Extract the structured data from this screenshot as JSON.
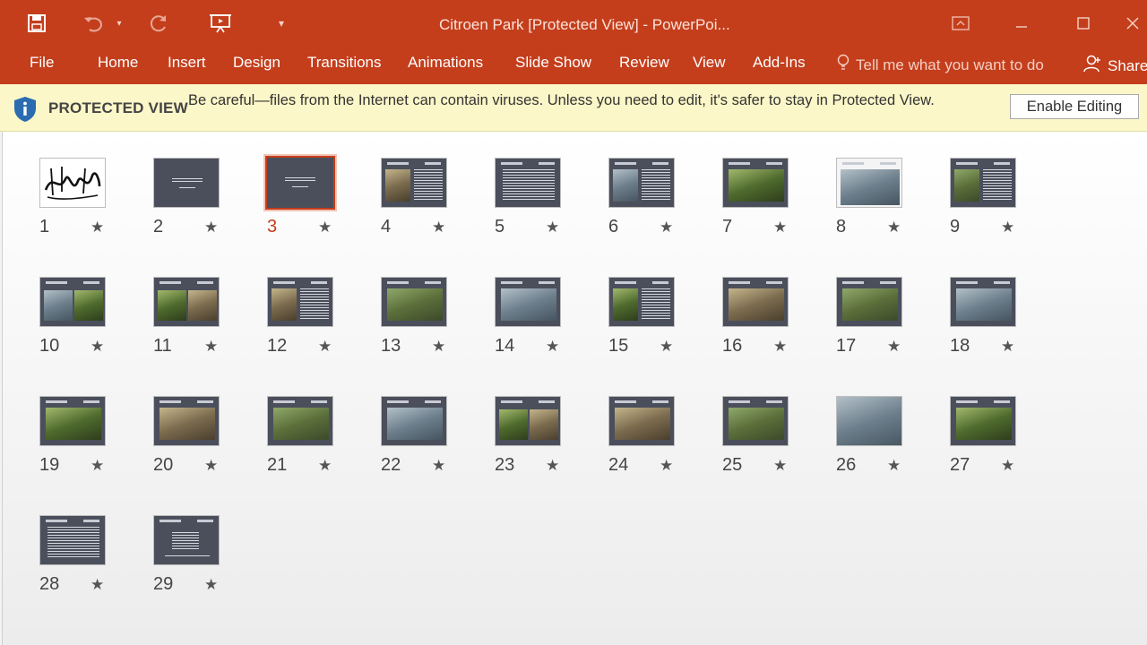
{
  "window": {
    "title": "Citroen Park [Protected View] - PowerPoi...",
    "icons": [
      "save-icon",
      "undo-icon",
      "redo-icon",
      "slideshow-from-start-icon",
      "customize-qat-icon",
      "ribbon-display-icon",
      "minimize-icon",
      "maximize-icon",
      "close-icon"
    ]
  },
  "ribbon": {
    "tabs": [
      "File",
      "Home",
      "Insert",
      "Design",
      "Transitions",
      "Animations",
      "Slide Show",
      "Review",
      "View",
      "Add-Ins"
    ],
    "tell_me": "Tell me what you want to do",
    "share": "Share"
  },
  "protected_view": {
    "title": "PROTECTED VIEW",
    "message": "Be careful—files from the Internet can contain viruses. Unless you need to edit, it's safer to stay in Protected View.",
    "button": "Enable Editing"
  },
  "colors": {
    "accent": "#c43e1c",
    "selected_number": "#c43e1c",
    "pv_bar": "#fcf7c8",
    "slide_bg": "#4b4f5c"
  },
  "slides": [
    {
      "num": "1",
      "kind": "calligraphy"
    },
    {
      "num": "2",
      "kind": "title"
    },
    {
      "num": "3",
      "kind": "title",
      "selected": true
    },
    {
      "num": "4",
      "kind": "photo-left"
    },
    {
      "num": "5",
      "kind": "text"
    },
    {
      "num": "6",
      "kind": "photo-left"
    },
    {
      "num": "7",
      "kind": "photo-wide"
    },
    {
      "num": "8",
      "kind": "map"
    },
    {
      "num": "9",
      "kind": "photo-left"
    },
    {
      "num": "10",
      "kind": "photo-two"
    },
    {
      "num": "11",
      "kind": "photo-two"
    },
    {
      "num": "12",
      "kind": "photo-left"
    },
    {
      "num": "13",
      "kind": "photo-wide"
    },
    {
      "num": "14",
      "kind": "photo-wide"
    },
    {
      "num": "15",
      "kind": "photo-left"
    },
    {
      "num": "16",
      "kind": "photo-wide"
    },
    {
      "num": "17",
      "kind": "photo-wide"
    },
    {
      "num": "18",
      "kind": "photo-wide"
    },
    {
      "num": "19",
      "kind": "photo-wide"
    },
    {
      "num": "20",
      "kind": "photo-wide"
    },
    {
      "num": "21",
      "kind": "photo-wide"
    },
    {
      "num": "22",
      "kind": "photo-wide"
    },
    {
      "num": "23",
      "kind": "photo-two"
    },
    {
      "num": "24",
      "kind": "photo-wide"
    },
    {
      "num": "25",
      "kind": "photo-wide"
    },
    {
      "num": "26",
      "kind": "photo-full"
    },
    {
      "num": "27",
      "kind": "photo-wide"
    },
    {
      "num": "28",
      "kind": "text"
    },
    {
      "num": "29",
      "kind": "text-green"
    }
  ]
}
